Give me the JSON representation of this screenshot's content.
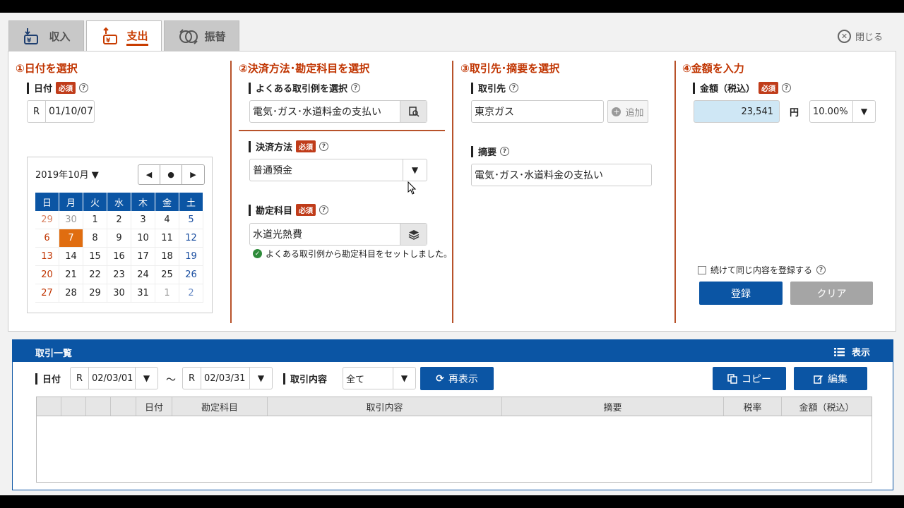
{
  "tabs": [
    {
      "label": "収入",
      "icon": "income-icon"
    },
    {
      "label": "支出",
      "icon": "expense-icon"
    },
    {
      "label": "振替",
      "icon": "transfer-icon"
    }
  ],
  "close_label": "閉じる",
  "required_label": "必須",
  "step1": {
    "title": "①日付を選択",
    "date_label": "日付",
    "era": "R",
    "date_value": "01/10/07",
    "calendar": {
      "month_label": "2019年10月",
      "weekdays": [
        "日",
        "月",
        "火",
        "水",
        "木",
        "金",
        "土"
      ],
      "weeks": [
        [
          "29",
          "30",
          "1",
          "2",
          "3",
          "4",
          "5"
        ],
        [
          "6",
          "7",
          "8",
          "9",
          "10",
          "11",
          "12"
        ],
        [
          "13",
          "14",
          "15",
          "16",
          "17",
          "18",
          "19"
        ],
        [
          "20",
          "21",
          "22",
          "23",
          "24",
          "25",
          "26"
        ],
        [
          "27",
          "28",
          "29",
          "30",
          "31",
          "1",
          "2"
        ]
      ],
      "selected_day": "7"
    }
  },
  "step2": {
    "title": "②決済方法･勘定科目を選択",
    "example_label": "よくある取引例を選択",
    "example_value": "電気･ガス･水道料金の支払い",
    "payment_label": "決済方法",
    "payment_value": "普通預金",
    "account_label": "勘定科目",
    "account_value": "水道光熱費",
    "notice": "よくある取引例から勘定科目をセットしました。"
  },
  "step3": {
    "title": "③取引先･摘要を選択",
    "partner_label": "取引先",
    "partner_value": "東京ガス",
    "add_label": "追加",
    "memo_label": "摘要",
    "memo_value": "電気･ガス･水道料金の支払い"
  },
  "step4": {
    "title": "④金額を入力",
    "amount_label": "金額（税込）",
    "amount_value": "23,541",
    "currency": "円",
    "tax_rate": "10.00%",
    "continue_label": "続けて同じ内容を登録する",
    "register_label": "登録",
    "clear_label": "クリア"
  },
  "list": {
    "title": "取引一覧",
    "display_label": "表示",
    "date_label": "日付",
    "from_era": "R",
    "from_date": "02/03/01",
    "tilde": "～",
    "to_era": "R",
    "to_date": "02/03/31",
    "content_label": "取引内容",
    "content_value": "全て",
    "refresh_label": "再表示",
    "copy_label": "コピー",
    "edit_label": "編集",
    "columns": [
      "",
      "",
      "",
      "",
      "日付",
      "勘定科目",
      "取引内容",
      "摘要",
      "税率",
      "金額（税込）"
    ]
  },
  "colors": {
    "accent": "#c03400",
    "primary": "#0b55a4",
    "amount_bg": "#cfe7f5",
    "selected_day": "#e06d10"
  }
}
